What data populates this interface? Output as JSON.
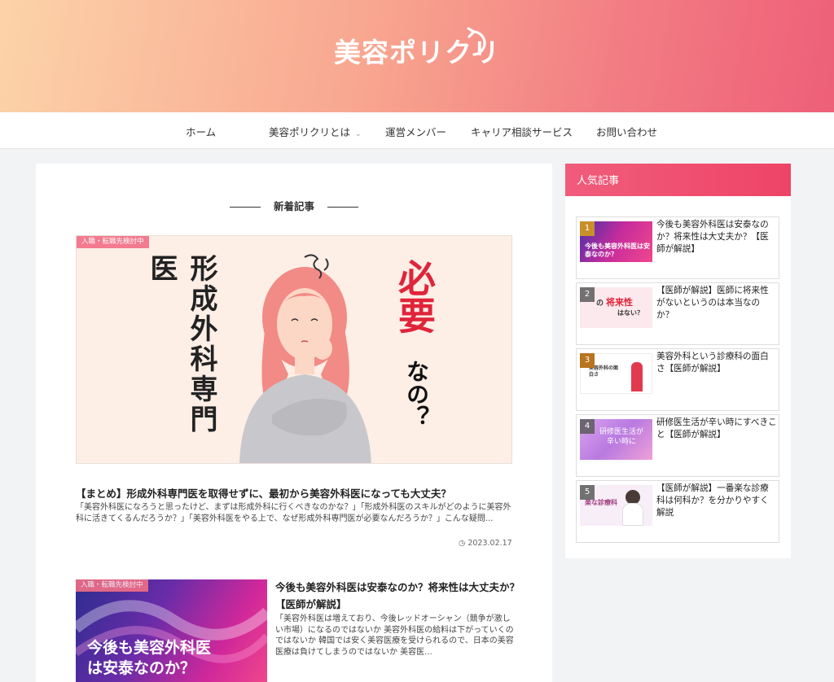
{
  "site": {
    "logo_text": "美容ポリクリ"
  },
  "nav": [
    {
      "label": "ホーム"
    },
    {
      "label": "美容ポリクリとは"
    },
    {
      "label": "運営メンバー"
    },
    {
      "label": "キャリア相談サービス"
    },
    {
      "label": "お問い合わせ"
    }
  ],
  "section_title": "新着記事",
  "featured": {
    "badge": "入職・転職先検討中",
    "image_vertical_text": "形成外科専門医",
    "image_red_text": "必要",
    "image_black_text": "なの？",
    "title": "【まとめ】形成外科専門医を取得せずに、最初から美容外科医になっても大丈夫？",
    "excerpt": "「美容外科医になろうと思ったけど、まずは形成外科に行くべきなのかな？」「形成外科医のスキルがどのように美容外科に活きてくるんだろうか？」「美容外科医をやる上で、なぜ形成外科専門医が必要なんだろうか？」こんな疑問...",
    "date": "2023.02.17"
  },
  "card2": {
    "badge": "入職・転職先検討中",
    "image_caption_1": "今後も美容外科医",
    "image_caption_2": "は安泰なのか？",
    "title": "今後も美容外科医は安泰なのか？将来性は大丈夫か？【医師が解説】",
    "excerpt": "「美容外科医は増えており、今後レッドオーシャン（競争が激しい市場）になるのではないか 美容外科医の給料は下がっていくのではないか 韓国では安く美容医療を受けられるので、日本の美容医療は負けてしまうのではないか 美容医..."
  },
  "sidebar": {
    "title": "人気記事",
    "items": [
      {
        "num": "1",
        "title": "今後も美容外科医は安泰なのか？将来性は大丈夫か？【医師が解説】",
        "thumb_text": "今後も美容外科医は安泰なのか？"
      },
      {
        "num": "2",
        "title": "【医師が解説】医師に将来性がないというのは本当なのか？",
        "thumb_text_1": "の",
        "thumb_text_2": "将来性",
        "thumb_text_3": "はない？"
      },
      {
        "num": "3",
        "title": "美容外科という診療科の面白さ【医師が解説】",
        "thumb_text": "美容外科の面白さ"
      },
      {
        "num": "4",
        "title": "研修医生活が辛い時にすべきこと【医師が解説】",
        "thumb_text_1": "研修医生活が",
        "thumb_text_2": "辛い時に"
      },
      {
        "num": "5",
        "title": "【医師が解説】一番楽な診療科は何科か？を分かりやすく解説",
        "thumb_text": "楽な診療科"
      }
    ]
  },
  "colors": {
    "accent": "#ee4466",
    "header_start": "#fcd3a9",
    "header_end": "#ee5f78"
  }
}
